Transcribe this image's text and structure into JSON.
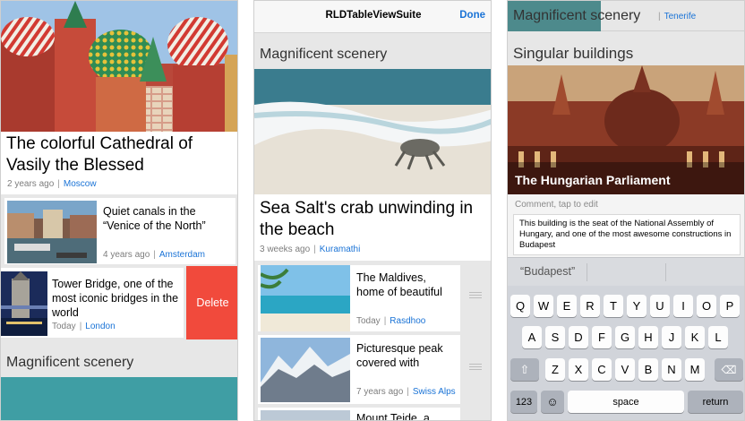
{
  "panel1": {
    "hero": {
      "title": "The colorful Cathedral of Vasily the Blessed",
      "time": "2 years ago",
      "location": "Moscow"
    },
    "rows": [
      {
        "title": "Quiet canals in the “Venice of the North”",
        "time": "4 years ago",
        "location": "Amsterdam"
      },
      {
        "title": "Tower Bridge, one of the most iconic bridges in the world",
        "time": "Today",
        "location": "London"
      }
    ],
    "delete_label": "Delete",
    "section_title": "Magnificent scenery"
  },
  "panel2": {
    "nav": {
      "title": "RLDTableViewSuite",
      "done": "Done"
    },
    "section_title": "Magnificent scenery",
    "hero": {
      "title": "Sea Salt's crab unwinding in the beach",
      "time": "3 weeks ago",
      "location": "Kuramathi"
    },
    "rows": [
      {
        "title": "The Maldives, home of beautiful",
        "time": "Today",
        "location": "Rasdhoo"
      },
      {
        "title": "Picturesque peak covered with",
        "time": "7 years ago",
        "location": "Swiss Alps"
      },
      {
        "title": "Mount Teide, a",
        "time": "",
        "location": ""
      }
    ]
  },
  "panel3": {
    "top_section": "Magnificent scenery",
    "top_location": "Tenerife",
    "section_title": "Singular buildings",
    "card_title": "The Hungarian Parliament",
    "comment_hint": "Comment, tap to edit",
    "comment_text": "This building is the seat of the National Assembly of Hungary, and one of the most awesome constructions in Budapest",
    "suggestion": "“Budapest”",
    "keyboard": {
      "row1": [
        "Q",
        "W",
        "E",
        "R",
        "T",
        "Y",
        "U",
        "I",
        "O",
        "P"
      ],
      "row2": [
        "A",
        "S",
        "D",
        "F",
        "G",
        "H",
        "J",
        "K",
        "L"
      ],
      "row3": [
        "Z",
        "X",
        "C",
        "V",
        "B",
        "N",
        "M"
      ],
      "numbers": "123",
      "space": "space",
      "return": "return"
    }
  },
  "colors": {
    "accent": "#1a73d6",
    "delete": "#f14a3c",
    "keyboard": "#d1d4da"
  }
}
